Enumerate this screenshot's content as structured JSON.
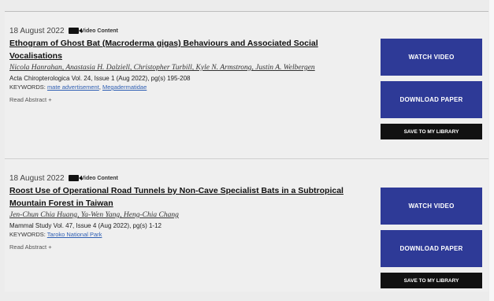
{
  "articles": [
    {
      "date": "18 August 2022",
      "badge": "Video Content",
      "title": "Ethogram of Ghost Bat (Macroderma gigas) Behaviours and Associated Social Vocalisations",
      "authors": "Nicola Hanrahan, Anastasia H. Dalziell, Christopher Turbill, Kyle N. Armstrong, Justin A. Welbergen",
      "journal": "Acta Chiropterologica Vol. 24, Issue 1 (Aug 2022), pg(s) 195-208",
      "keywords_label": "KEYWORDS:",
      "keywords": [
        "mate advertisement",
        "Megadermatidae"
      ],
      "read_abstract": "Read Abstract +",
      "watch_label": "WATCH VIDEO",
      "download_label": "DOWNLOAD PAPER",
      "library_label": "SAVE TO MY LIBRARY"
    },
    {
      "date": "18 August 2022",
      "badge": "Video Content",
      "title": "Roost Use of Operational Road Tunnels by Non-Cave Specialist Bats in a Subtropical Mountain Forest in Taiwan",
      "authors": "Jen-Chun Chia Huang, Ya-Wen Yang, Heng-Chia Chang",
      "journal": "Mammal Study Vol. 47, Issue 4 (Aug 2022), pg(s) 1-12",
      "keywords_label": "KEYWORDS:",
      "keywords": [
        "Taroko National Park"
      ],
      "read_abstract": "Read Abstract +",
      "watch_label": "WATCH VIDEO",
      "download_label": "DOWNLOAD PAPER",
      "library_label": "SAVE TO MY LIBRARY"
    }
  ],
  "icons": {
    "video": "video-camera-icon"
  },
  "colors": {
    "button": "#2e3a97",
    "library_button": "#111111",
    "keyword_link": "#2f5fb3"
  }
}
